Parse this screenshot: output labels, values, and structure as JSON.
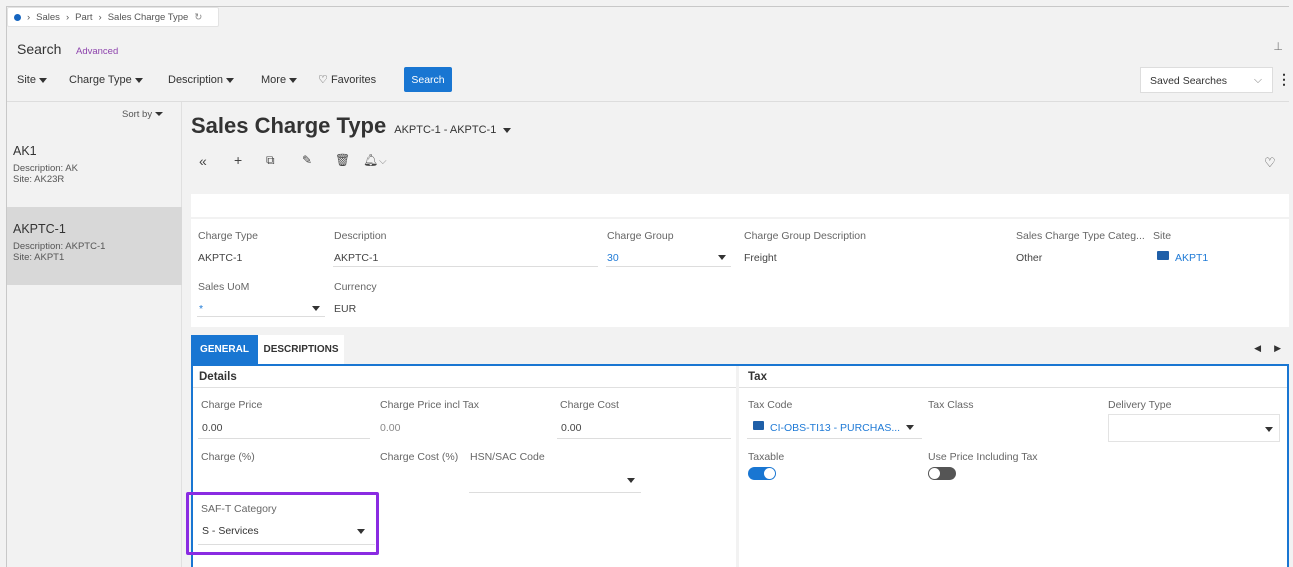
{
  "breadcrumb": {
    "items": [
      "Sales",
      "Part",
      "Sales Charge Type"
    ]
  },
  "search": {
    "title": "Search",
    "advanced": "Advanced",
    "filters": [
      "Site",
      "Charge Type",
      "Description",
      "More"
    ],
    "favorites": "Favorites",
    "button": "Search",
    "saved_searches": "Saved Searches"
  },
  "sidebar": {
    "sort_by": "Sort by",
    "items": [
      {
        "title": "AK1",
        "desc_label": "Description:",
        "desc": "AK",
        "site_label": "Site:",
        "site": "AK23R"
      },
      {
        "title": "AKPTC-1",
        "desc_label": "Description:",
        "desc": "AKPTC-1",
        "site_label": "Site:",
        "site": "AKPT1"
      }
    ]
  },
  "page": {
    "title": "Sales Charge Type",
    "record": "AKPTC-1 - AKPTC-1"
  },
  "header_fields": {
    "charge_type": {
      "label": "Charge Type",
      "value": "AKPTC-1"
    },
    "description": {
      "label": "Description",
      "value": "AKPTC-1"
    },
    "charge_group": {
      "label": "Charge Group",
      "value": "30"
    },
    "charge_group_desc": {
      "label": "Charge Group Description",
      "value": "Freight"
    },
    "category": {
      "label": "Sales Charge Type Categ...",
      "value": "Other"
    },
    "site": {
      "label": "Site",
      "value": "AKPT1"
    },
    "sales_uom": {
      "label": "Sales UoM",
      "value": "*"
    },
    "currency": {
      "label": "Currency",
      "value": "EUR"
    }
  },
  "tabs": [
    "GENERAL",
    "DESCRIPTIONS"
  ],
  "details": {
    "title": "Details",
    "charge_price": {
      "label": "Charge Price",
      "value": "0.00"
    },
    "charge_price_incl": {
      "label": "Charge Price incl Tax",
      "value": "0.00"
    },
    "charge_cost": {
      "label": "Charge Cost",
      "value": "0.00"
    },
    "charge_pct": {
      "label": "Charge (%)"
    },
    "charge_cost_pct": {
      "label": "Charge Cost (%)"
    },
    "hsn": {
      "label": "HSN/SAC Code"
    },
    "saft": {
      "label": "SAF-T Category",
      "value": "S - Services"
    }
  },
  "tax": {
    "title": "Tax",
    "tax_code": {
      "label": "Tax Code",
      "value": "CI-OBS-TI13 - PURCHAS..."
    },
    "tax_class": {
      "label": "Tax Class"
    },
    "delivery_type": {
      "label": "Delivery Type"
    },
    "taxable": {
      "label": "Taxable"
    },
    "use_price_incl": {
      "label": "Use Price Including Tax"
    }
  },
  "colors": {
    "accent": "#1976d2",
    "highlight": "#8a2be2",
    "link": "#1f7ad6"
  }
}
